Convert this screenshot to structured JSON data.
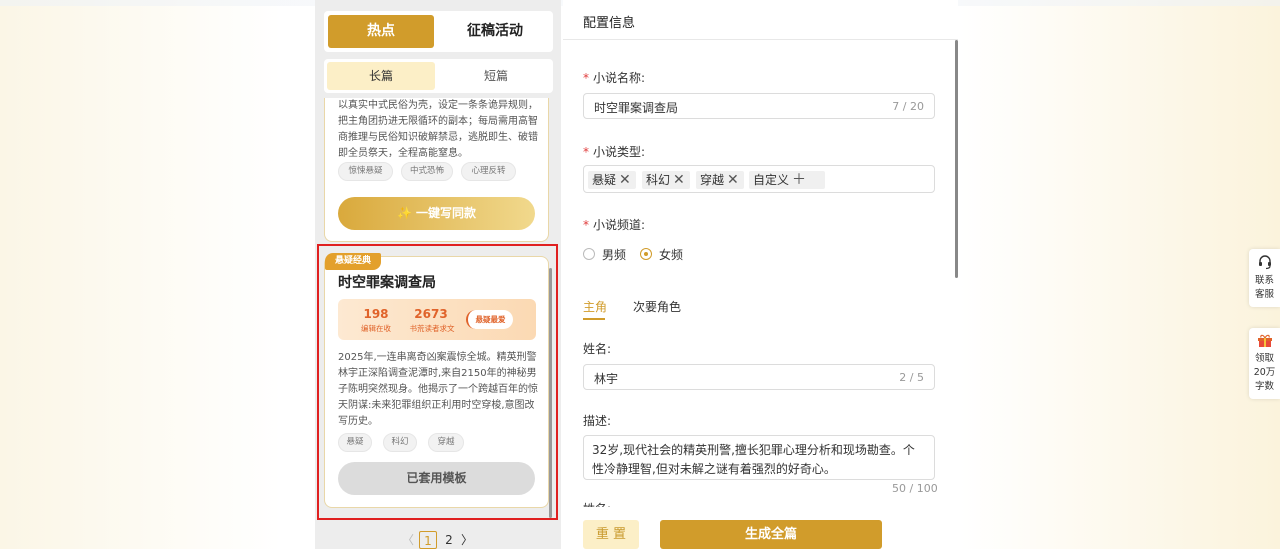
{
  "left": {
    "tabs": [
      "热点",
      "征稿活动"
    ],
    "subtabs": [
      "长篇",
      "短篇"
    ],
    "card1": {
      "description": "以真实中式民俗为壳，设定一条条诡异规则，把主角团扔进无限循环的副本；每局需用高智商推理与民俗知识破解禁忌，逃脱即生、破错即全员祭天，全程高能窒息。",
      "tags": [
        "惊悚悬疑",
        "中式恐怖",
        "心理反转"
      ],
      "button": "一键写同款",
      "spark": "✨"
    },
    "card2": {
      "badge": "悬疑经典",
      "title": "时空罪案调查局",
      "stat1_value": "198",
      "stat1_label": "编辑在收",
      "stat2_value": "2673",
      "stat2_label": "书荒读者求文",
      "stat_pill": "悬疑最爱",
      "description": "2025年,一连串离奇凶案震惊全城。精英刑警林宇正深陷调查泥潭时,来自2150年的神秘男子陈明突然现身。他揭示了一个跨越百年的惊天阴谋:未来犯罪组织正利用时空穿梭,意图改写历史。",
      "tags": [
        "悬疑",
        "科幻",
        "穿越"
      ],
      "button": "已套用模板"
    },
    "pager": {
      "prev": "〈",
      "p1": "1",
      "p2": "2",
      "next": "〉"
    }
  },
  "right": {
    "header": "配置信息",
    "name_label": "小说名称:",
    "name_value": "时空罪案调查局",
    "name_count": "7 / 20",
    "type_label": "小说类型:",
    "type_chips": [
      "悬疑",
      "科幻",
      "穿越"
    ],
    "type_custom": "自定义",
    "channel_label": "小说频道:",
    "channel_options": [
      "男频",
      "女频"
    ],
    "channel_selected": "女频",
    "role_tabs": [
      "主角",
      "次要角色"
    ],
    "role_name_label": "姓名:",
    "role_name_value": "林宇",
    "role_name_count": "2 / 5",
    "desc_label": "描述:",
    "desc_value": "32岁,现代社会的精英刑警,擅长犯罪心理分析和现场勘查。个性冷静理智,但对未解之谜有着强烈的好奇心。",
    "desc_count": "50 / 100",
    "cut_label": "姓名:",
    "reset_button": "重 置",
    "generate_button": "生成全篇"
  },
  "side": {
    "service_label": [
      "联系",
      "客服"
    ],
    "gift_label": [
      "领取",
      "20万",
      "字数"
    ]
  },
  "colors": {
    "accent": "#d19c2b",
    "highlight_border": "#e02020",
    "stat_orange": "#e0632a"
  }
}
